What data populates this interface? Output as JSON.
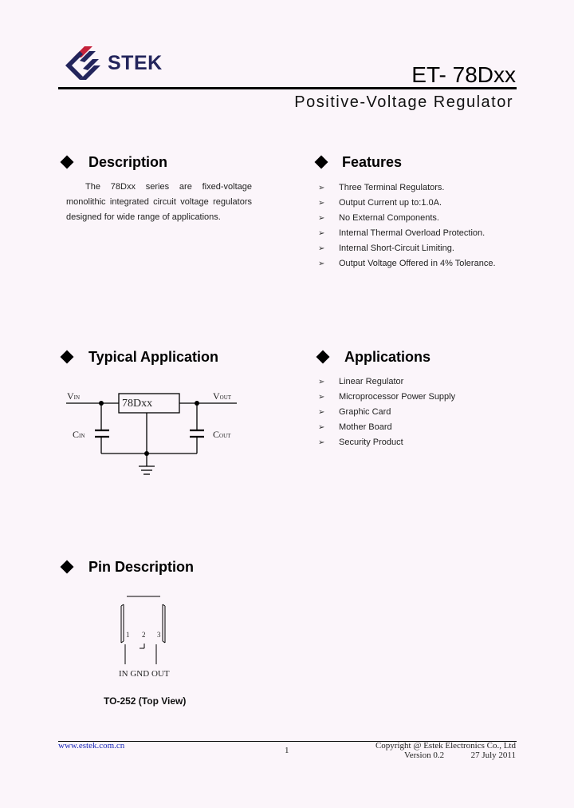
{
  "header": {
    "brand": "STEK",
    "part_number": "ET- 78Dxx",
    "subtitle": "Positive-Voltage Regulator",
    "logo_colors": {
      "accent": "#c4213a",
      "primary": "#23255c"
    }
  },
  "description": {
    "title": "Description",
    "text": "The 78Dxx series are fixed-voltage monolithic integrated circuit voltage regulators designed for wide range of applications."
  },
  "features": {
    "title": "Features",
    "items": [
      "Three Terminal Regulators.",
      "Output Current up to:1.0A.",
      "No External Components.",
      "Internal Thermal Overload Protection.",
      "Internal Short-Circuit Limiting.",
      "Output Voltage Offered in 4% Tolerance."
    ]
  },
  "typical_application": {
    "title": "Typical Application",
    "ic_label": "78Dxx",
    "vin": {
      "main": "V",
      "sub": "IN"
    },
    "vout": {
      "main": "V",
      "sub": "OUT"
    },
    "cin": {
      "main": "C",
      "sub": "IN"
    },
    "cout": {
      "main": "C",
      "sub": "OUT"
    }
  },
  "applications": {
    "title": "Applications",
    "items": [
      "Linear Regulator",
      "Microprocessor Power Supply",
      "Graphic Card",
      "Mother Board",
      "Security Product"
    ]
  },
  "pin_description": {
    "title": "Pin Description",
    "pin_numbers": [
      "1",
      "2",
      "3"
    ],
    "pin_names": "IN GND OUT",
    "caption": "TO-252 (Top View)"
  },
  "footer": {
    "url": "www.estek.com.cn",
    "page": "1",
    "copyright": "Copyright @ Estek Electronics Co., Ltd",
    "version": "Version 0.2",
    "date": "27 July 2011"
  },
  "icons": {
    "bullet": "➢"
  }
}
